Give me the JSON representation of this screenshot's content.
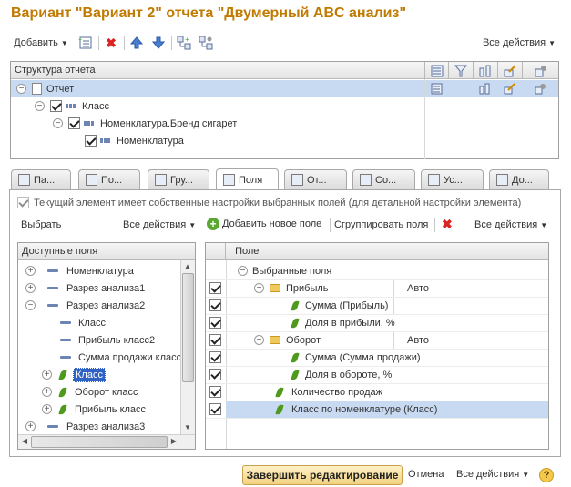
{
  "title": "Вариант \"Вариант 2\" отчета \"Двумерный ABC анализ\"",
  "toolbar": {
    "add_label": "Добавить",
    "all_actions": "Все действия"
  },
  "structure": {
    "header": "Структура отчета",
    "rows": [
      {
        "label": "Отчет"
      },
      {
        "label": "Класс"
      },
      {
        "label": "Номенклатура.Бренд сигарет"
      },
      {
        "label": "Номенклатура"
      }
    ]
  },
  "tabs": [
    "Па...",
    "По...",
    "Гру...",
    "Поля",
    "От...",
    "Со...",
    "Ус...",
    "До..."
  ],
  "own_settings_text": "Текущий элемент имеет собственные настройки выбранных полей (для детальной настройки элемента)",
  "fields_toolbar": {
    "select": "Выбрать",
    "all_actions_left": "Все действия",
    "add_new_field": "Добавить новое поле",
    "group_fields": "Сгруппировать поля",
    "all_actions_right": "Все действия"
  },
  "available": {
    "header": "Доступные поля",
    "rows": [
      {
        "label": "Номенклатура",
        "expander": "+"
      },
      {
        "label": "Разрез анализа1",
        "expander": "+"
      },
      {
        "label": "Разрез анализа2",
        "expander": "−"
      },
      {
        "label": "Класс"
      },
      {
        "label": "Прибыль класс2"
      },
      {
        "label": "Сумма продажи класс"
      },
      {
        "label": "Класс",
        "expander": "+"
      },
      {
        "label": "Оборот класс",
        "expander": "+"
      },
      {
        "label": "Прибыль класс",
        "expander": "+"
      },
      {
        "label": "Разрез анализа3",
        "expander": "+"
      }
    ]
  },
  "selected": {
    "header": "Поле",
    "root": "Выбранные поля",
    "rows": [
      {
        "label": "Прибыль",
        "extra": "Авто"
      },
      {
        "label": "Сумма (Прибыль)"
      },
      {
        "label": "Доля в прибыли, %"
      },
      {
        "label": "Оборот",
        "extra": "Авто"
      },
      {
        "label": "Сумма (Сумма продажи)"
      },
      {
        "label": "Доля в обороте, %"
      },
      {
        "label": "Количество продаж"
      },
      {
        "label": "Класс по номенклатуре (Класс)"
      }
    ]
  },
  "footer": {
    "finish": "Завершить редактирование",
    "cancel": "Отмена",
    "all_actions": "Все действия",
    "help": "?"
  }
}
